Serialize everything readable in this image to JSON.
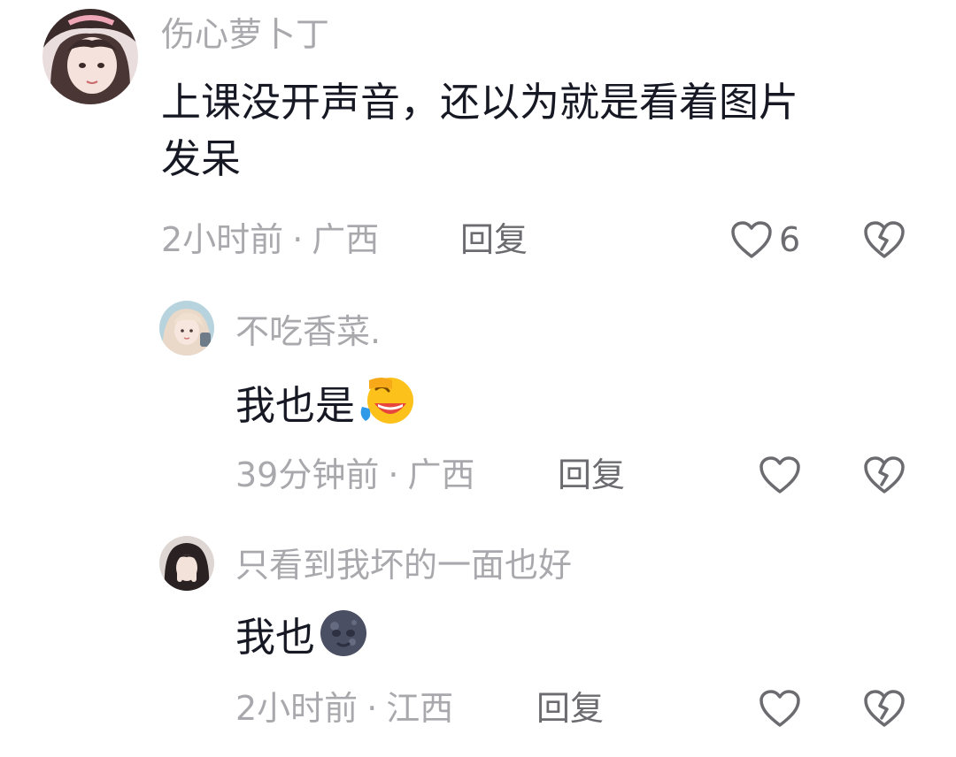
{
  "comments": [
    {
      "username": "伤心萝卜丁",
      "text_lines": [
        "上课没开声音，还以为就是看着图片",
        "发呆"
      ],
      "time": "2小时前",
      "location": "广西",
      "reply_label": "回复",
      "like_count": "6",
      "avatar_icon": "avatar-girl-pink"
    },
    {
      "username": "不吃香菜.",
      "text": "我也是",
      "emoji": "face-with-tears-of-joy",
      "time": "39分钟前",
      "location": "广西",
      "reply_label": "回复",
      "like_count": "",
      "avatar_icon": "avatar-girl-blonde"
    },
    {
      "username": "只看到我坏的一面也好",
      "text": "我也",
      "emoji": "new-moon-face",
      "time": "2小时前",
      "location": "江西",
      "reply_label": "回复",
      "like_count": "",
      "avatar_icon": "avatar-girl-dark-hair"
    }
  ],
  "colors": {
    "muted": "#a9a9ad",
    "text": "#161823",
    "action": "#6b6b70"
  },
  "separator": "·"
}
